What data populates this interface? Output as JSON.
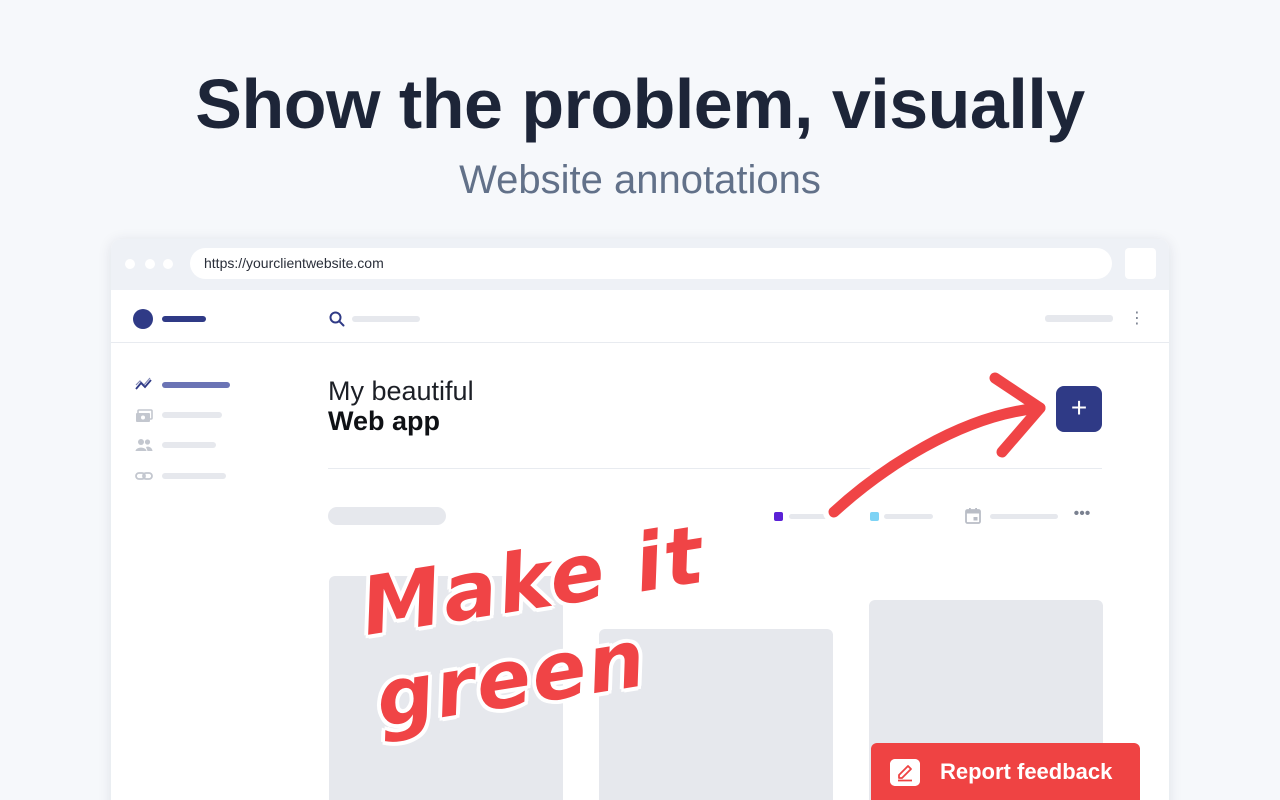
{
  "hero": {
    "title": "Show the problem, visually",
    "subtitle": "Website annotations"
  },
  "browser": {
    "url": "https://yourclientwebsite.com"
  },
  "app": {
    "heading_line1": "My beautiful",
    "heading_line2": "Web app",
    "add_button_icon": "+",
    "more_icon": "•••",
    "kebab_icon": "⋮"
  },
  "annotation": {
    "text": "Make it green",
    "color": "#f04446"
  },
  "feedback": {
    "label": "Report feedback"
  },
  "colors": {
    "accent": "#2f3a86",
    "legend_purple": "#5b21d6",
    "legend_cyan": "#7dd3f5",
    "feedback_red": "#ef4343"
  }
}
